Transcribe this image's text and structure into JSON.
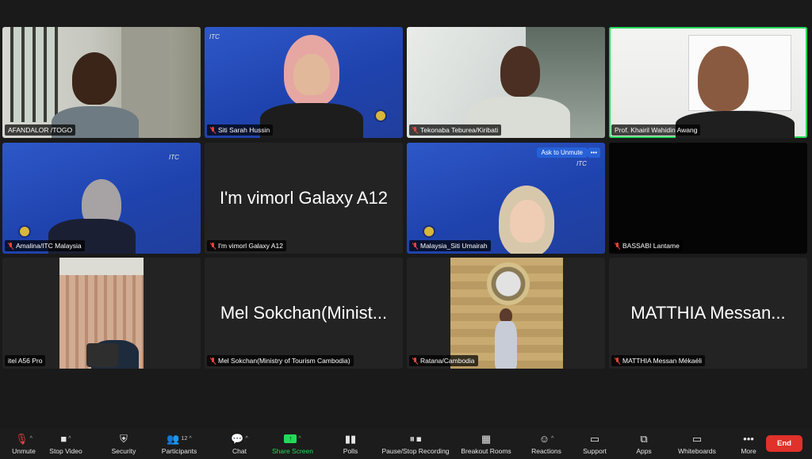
{
  "tiles": [
    {
      "name": "AFANDALOR /TOGO",
      "muted": false
    },
    {
      "name": "Siti Sarah Hussin",
      "muted": true
    },
    {
      "name": "Tekonaba Teburea/Kiribati",
      "muted": true
    },
    {
      "name": "Prof. Khairil Wahidin Awang",
      "muted": false,
      "active": true
    },
    {
      "name": "Amalina/ITC Malaysia",
      "muted": true
    },
    {
      "name": "I'm vimorl Galaxy A12",
      "muted": true,
      "display": "I'm vimorl Galaxy A12"
    },
    {
      "name": "Malaysia_Siti Umairah",
      "muted": true,
      "ask_unmute": "Ask to Unmute",
      "more": "•••"
    },
    {
      "name": "BASSABI Lantame",
      "muted": true
    },
    {
      "name": "itel A56 Pro",
      "muted": false
    },
    {
      "name": "Mel Sokchan(Ministry of Tourism Cambodia)",
      "muted": true,
      "display": "Mel Sokchan(Minist..."
    },
    {
      "name": "Ratana/Cambodia",
      "muted": true
    },
    {
      "name": "MATTHIA Messan Mékaéli",
      "muted": true,
      "display": "MATTHIA Messan..."
    }
  ],
  "toolbar": {
    "unmute": "Unmute",
    "stop_video": "Stop Video",
    "security": "Security",
    "participants": "Participants",
    "participants_count": "12",
    "chat": "Chat",
    "share_screen": "Share Screen",
    "polls": "Polls",
    "pause_stop_recording": "Pause/Stop Recording",
    "breakout_rooms": "Breakout Rooms",
    "reactions": "Reactions",
    "support": "Support",
    "apps": "Apps",
    "whiteboards": "Whiteboards",
    "more": "More",
    "end": "End"
  },
  "colors": {
    "accent_green": "#23d959",
    "end_red": "#e0312b",
    "mute_red": "#e8433c",
    "virtual_bg_blue": "#2e58c8"
  }
}
